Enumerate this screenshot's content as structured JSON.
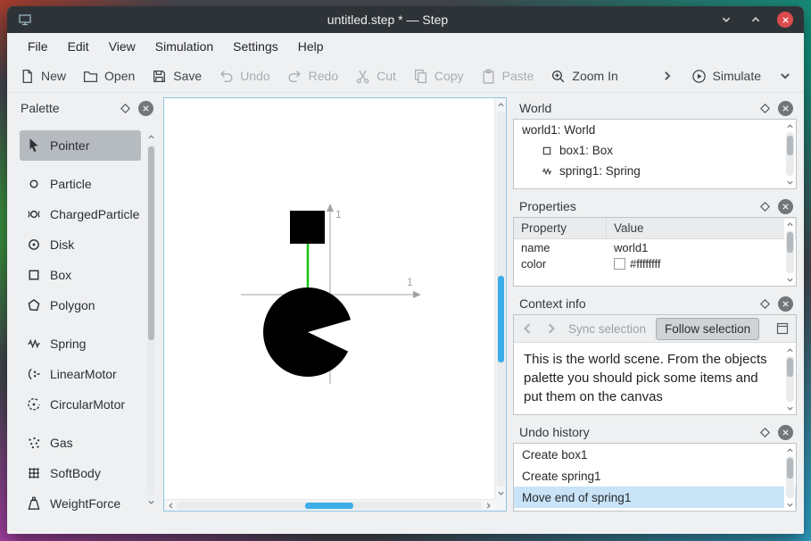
{
  "window": {
    "title": "untitled.step * — Step"
  },
  "menubar": {
    "items": [
      {
        "label": "File"
      },
      {
        "label": "Edit"
      },
      {
        "label": "View"
      },
      {
        "label": "Simulation"
      },
      {
        "label": "Settings"
      },
      {
        "label": "Help"
      }
    ]
  },
  "toolbar": {
    "buttons": [
      {
        "label": "New",
        "enabled": true
      },
      {
        "label": "Open",
        "enabled": true
      },
      {
        "label": "Save",
        "enabled": true
      },
      {
        "label": "Undo",
        "enabled": false
      },
      {
        "label": "Redo",
        "enabled": false
      },
      {
        "label": "Cut",
        "enabled": false
      },
      {
        "label": "Copy",
        "enabled": false
      },
      {
        "label": "Paste",
        "enabled": false
      },
      {
        "label": "Zoom In",
        "enabled": true
      },
      {
        "label": "Simulate",
        "enabled": true
      }
    ]
  },
  "palette": {
    "title": "Palette",
    "items": [
      {
        "label": "Pointer",
        "selected": true
      },
      {
        "label": "Particle",
        "selected": false
      },
      {
        "label": "ChargedParticle",
        "selected": false
      },
      {
        "label": "Disk",
        "selected": false
      },
      {
        "label": "Box",
        "selected": false
      },
      {
        "label": "Polygon",
        "selected": false
      },
      {
        "label": "Spring",
        "selected": false
      },
      {
        "label": "LinearMotor",
        "selected": false
      },
      {
        "label": "CircularMotor",
        "selected": false
      },
      {
        "label": "Gas",
        "selected": false
      },
      {
        "label": "SoftBody",
        "selected": false
      },
      {
        "label": "WeightForce",
        "selected": false
      }
    ]
  },
  "canvas": {
    "x_axis_label": "1",
    "y_axis_label": "1"
  },
  "world_panel": {
    "title": "World",
    "items": [
      {
        "label": "world1: World"
      },
      {
        "label": "box1: Box"
      },
      {
        "label": "spring1: Spring"
      }
    ]
  },
  "properties_panel": {
    "title": "Properties",
    "columns": {
      "property": "Property",
      "value": "Value"
    },
    "rows": [
      {
        "property": "name",
        "value": "world1"
      },
      {
        "property": "color",
        "value": "#ffffffff",
        "swatch": "#ffffff"
      }
    ]
  },
  "context_panel": {
    "title": "Context info",
    "sync_button": "Sync selection",
    "follow_button": "Follow selection",
    "text": "This is the world scene. From the objects palette you should pick some items and put them on the canvas"
  },
  "undo_panel": {
    "title": "Undo history",
    "items": [
      {
        "label": "Create box1",
        "selected": false
      },
      {
        "label": "Create spring1",
        "selected": false
      },
      {
        "label": "Move end of spring1",
        "selected": true
      }
    ]
  },
  "colors": {
    "accent": "#3daee9",
    "titlebar": "#2e3338",
    "window_bg": "#eff0f1",
    "selection_row": "#c9e4f7",
    "spring_green": "#15c515",
    "canvas_border": "#8fc6e2",
    "close_button_red": "#dd4a4d"
  }
}
